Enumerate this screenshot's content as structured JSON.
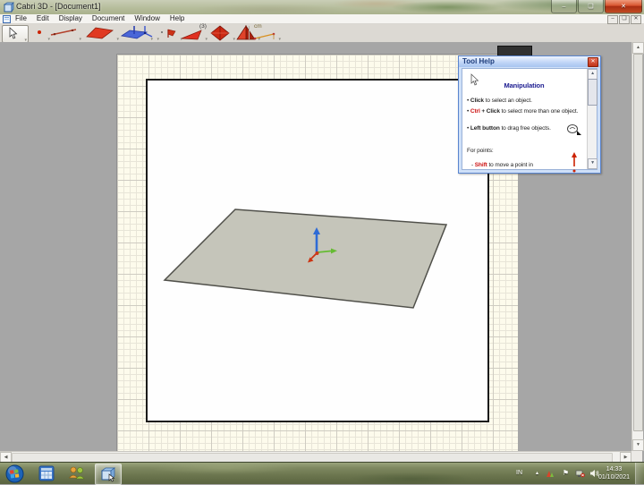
{
  "window": {
    "title": "Cabri 3D - [Document1]",
    "menu": [
      "File",
      "Edit",
      "Display",
      "Document",
      "Window",
      "Help"
    ]
  },
  "toolbar": {
    "polygon_count_label": "(3)",
    "measure_label": "cm",
    "tool_names": [
      "manipulation",
      "point",
      "line",
      "plane",
      "perpendicular-plane",
      "axes",
      "half-plane",
      "polygon",
      "polyhedron",
      "tetrahedron",
      "measurement"
    ]
  },
  "tool_help": {
    "title": "Tool Help",
    "heading": "Manipulation",
    "bullet": "• ",
    "l1_b": "Click",
    "l1_rest": " to select an object.",
    "l2_r": "Ctrl",
    "l2_m": " + ",
    "l2_b": "Click",
    "l2_rest": " to select more than one object.",
    "l3_b": "Left button",
    "l3_rest": " to drag free objects.",
    "l4": "For points:",
    "l5_pre": "- ",
    "l5_r": "Shift",
    "l5_rest": " to move a point in"
  },
  "tray": {
    "language": "IN",
    "time": "14:33",
    "date": "01/10/2021"
  },
  "glyphs": {
    "minimize": "–",
    "restore": "❏",
    "close": "✕",
    "dropdown": "▾",
    "scroll_up": "▲",
    "scroll_down": "▼",
    "scroll_left": "◀",
    "scroll_right": "▶",
    "hidden_icons": "▴",
    "flag": "⚑"
  },
  "colors": {
    "axis_x": "#cc3311",
    "axis_y": "#66bb33",
    "axis_z": "#2e6bd6",
    "plane_fill": "#c5c5ba",
    "accent_red": "#cc1111",
    "help_heading": "#1b1b90"
  }
}
